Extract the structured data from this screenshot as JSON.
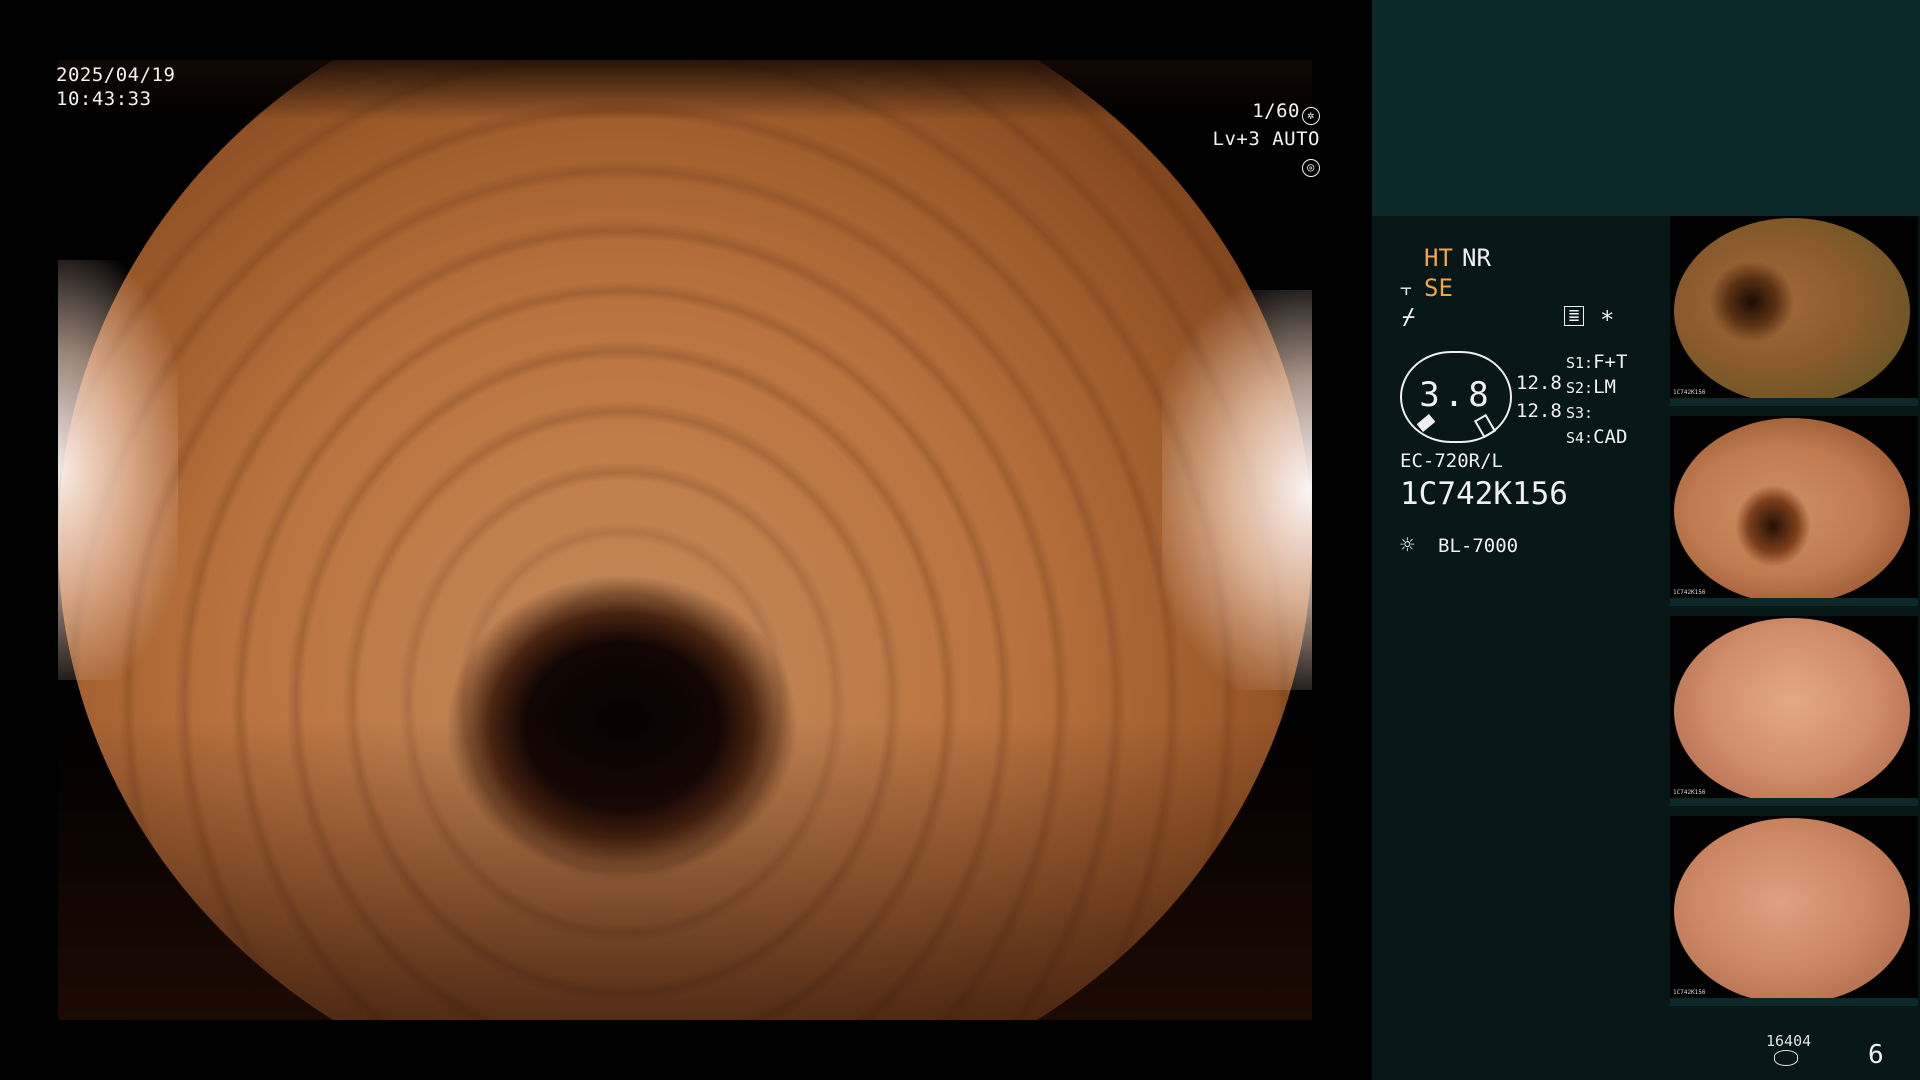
{
  "osd": {
    "date": "2025/04/19",
    "time": "10:43:33",
    "shutter": "1/60",
    "level": "Lv+3",
    "iris": "AUTO"
  },
  "panel": {
    "ht": "HT",
    "nr": "NR",
    "se": "SE",
    "gauge_value": "3.8",
    "gauge_side_1": "12.8",
    "gauge_side_2": "12.8",
    "s1_label": "S1:",
    "s1_value": "F+T",
    "s2_label": "S2:",
    "s2_value": "LM",
    "s3_label": "S3:",
    "s3_value": "",
    "s4_label": "S4:",
    "s4_value": "CAD",
    "scope_model": "EC-720R/L",
    "scope_serial": "1C742K156",
    "light_source": "BL-7000",
    "asterisk": "*"
  },
  "thumbnails": [
    {
      "label": "1C742K156"
    },
    {
      "label": "1C742K156"
    },
    {
      "label": "1C742K156"
    },
    {
      "label": "1C742K156"
    }
  ],
  "footer": {
    "count": "16404",
    "frame": "6"
  },
  "colors": {
    "accent_orange": "#f5a34a",
    "panel_bg": "#071617",
    "panel_top": "#0d2828"
  }
}
